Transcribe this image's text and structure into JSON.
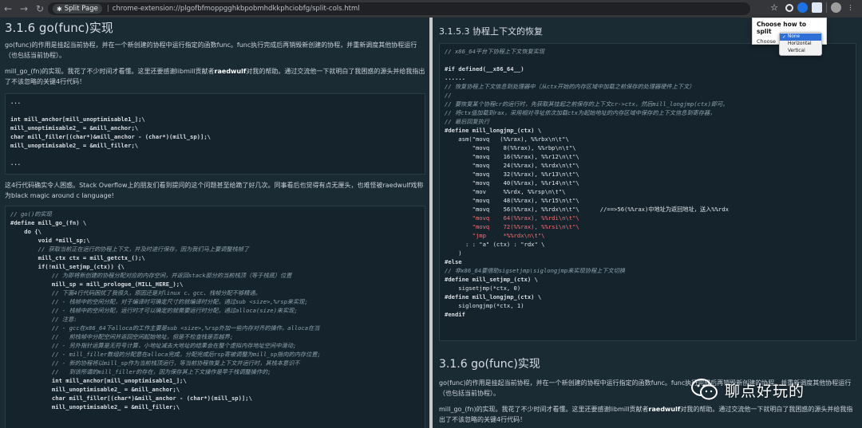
{
  "browser": {
    "back_icon": "←",
    "forward_icon": "→",
    "reload_icon": "↻",
    "ext_name": "Split Page",
    "url": "chrome-extension://plgofbfmoppgghkbpobmhdkkphciobfg/split-cols.html",
    "star_icon": "☆"
  },
  "popup": {
    "title": "Choose how to split",
    "choose_label": "Choose",
    "options": [
      {
        "label": "None",
        "selected": true,
        "check": "✓"
      },
      {
        "label": "Horizontal",
        "selected": false,
        "check": ""
      },
      {
        "label": "Vertical",
        "selected": false,
        "check": ""
      }
    ]
  },
  "left": {
    "heading": "3.1.6 go(func)实现",
    "para1": "go(func)的作用是挂起当前协程，并在一个新创建的协程中运行指定的函数func。func执行完成后再销毁新创建的协程，并重新调度其他协程运行（也包括当前协程）。",
    "para2_a": "mill_go_(fn)的实现。我花了不少时间才看懂。这里还要感谢libmill贡献者",
    "para2_b": "raedwulf",
    "para2_c": "对我的帮助。通过交流他一下就明白了我困惑的源头并给我指出了不该忽略的关键4行代码！",
    "code1": [
      "...",
      "",
      "int mill_anchor[mill_unoptimisable1_];\\",
      "mill_unoptimisable2_ = &mill_anchor;\\",
      "char mill_filler[(char*)&mill_anchor - (char*)(mill_sp)];\\",
      "mill_unoptimisable2_ = &mill_filler;\\",
      "",
      "..."
    ],
    "para3": "这4行代码确实令人困惑。Stack Overflow上的朋友们看到提问的这个问题甚至给跪了好几次。同事看后也觉得有点无厘头，也难怪被raedwulf戏称为black magic around c language!",
    "code2": [
      "// go()的实现",
      "#define mill_go_(fn) \\",
      "    do {\\",
      "        void *mill_sp;\\",
      "        // 获取当前正在运行的协程上下文，并及时进行保存，因为我们马上要调整栈帧了",
      "        mill_ctx ctx = mill_getctx_();\\",
      "        if(!mill_setjmp_(ctx)) {\\",
      "            // 为即将新创建的协程分配对应的内存空间，并返回stack部分的当前栈顶（等于栈底）位置",
      "            mill_sp = mill_prologue_(MILL_HERE_);\\",
      "            // 下面4行代码困扰了我很久，原因还是对linux c、gcc、栈帧分配不够精通。",
      "            // - 栈帧中的空间分配，对于编译时可确定尺寸的就编译时分配，通过sub <size>,%rsp来实现;",
      "            // - 栈帧中的空间分配，运行时才可以确定的就需要运行时分配，通过alloca(size)来实现;",
      "            // 注意:",
      "            // - gcc在x86_64下alloca的工作主要是sub <size>,%rsp外加一些内存对齐的操作。alloca在当",
      "            //   前栈帧中分配空间并返回空间起始地址，但是不检查栈是否越界;",
      "            // - 另外指针运算是无符号计算，小地址减去大地址的结果会在整个虚拟内存地址空间中滑动;",
      "            // - mill_filler数组的分配意在alloca完成，分配完成后rsp寄被调整为mill_sp指向的内存位置;",
      "            // - 新的协程将以mill_sp作为当前栈顶运行，等当前协程恢复上下文并运行时，其栈本意识不",
      "            //   到该所谓的mill_filler的存在，因为保存其上下文操作是早于栈调整操作的;",
      "            int mill_anchor[mill_unoptimisable1_];\\",
      "            mill_unoptimisable2_ = &mill_anchor;\\",
      "            char mill_filler[(char*)&mill_anchor - (char*)(mill_sp)];\\",
      "            mill_unoptimisable2_ = &mill_filler;\\"
    ]
  },
  "right": {
    "heading1": "3.1.5.3 协程上下文的恢复",
    "code3": [
      "// x86_64平台下协程上下文恢复实现",
      "",
      "#if defined(__x86_64__)",
      "......",
      "// 恢复协程上下文信息到处理器中（从ctx开始的内存区域中加载之前保存的处理器硬件上下文）",
      "//",
      "// 要恢复某个协程cr的运行时，先获取其挂起之前保存的上下文cr->ctx，然后mill_longjmp(ctx)即可。",
      "// 将ctx值加载到rax，采用相对寻址依次加载ctx为起始地址的内存区域中保存的上下文信息到寄存器，",
      "// 最后回复执行",
      "#define mill_longjmp_(ctx) \\",
      "    asm(\"movq   (%%rax), %%rbx\\n\\t\"\\",
      "        \"movq    8(%%rax), %%rbp\\n\\t\"\\",
      "        \"movq    16(%%rax), %%r12\\n\\t\"\\",
      "        \"movq    24(%%rax), %%rdx\\n\\t\"\\",
      "        \"movq    32(%%rax), %%r13\\n\\t\"\\",
      "        \"movq    40(%%rax), %%r14\\n\\t\"\\",
      "        \"mov     %%rdx, %%rsp\\n\\t\"\\",
      "        \"movq    48(%%rax), %%r15\\n\\t\"\\",
      "        \"movq    56(%%rax), %%rdx\\n\\t\"\\      //==>56(%%rax)中地址为返回地址，送入%%rdx",
      "        \"movq    64(%%rax), %%rdi\\n\\t\"\\",
      "        \"movq    72(%%rax), %%rsi\\n\\t\"\\",
      "        \"jmp     *%%rdx\\n\\t\"\\",
      "      : : \"a\" (ctx) : \"rdx\" \\",
      "    )",
      "#else",
      "// 非x86_64要借助sigsetjmp\\siglongjmp来实现协程上下文切换",
      "#define mill_setjmp_(ctx) \\",
      "    sigsetjmp(*ctx, 0)",
      "#define mill_longjmp_(ctx) \\",
      "    siglongjmp(*ctx, 1)",
      "#endif"
    ],
    "heading2": "3.1.6 go(func)实现",
    "para1": "go(func)的作用是挂起当前协程，并在一个新创建的协程中运行指定的函数func。func执行完成后再销毁新创建的协程，并重新调度其他协程运行（也包括当前协程）。",
    "para2_a": "mill_go_(fn)的实现。我花了不少时间才看懂。这里还要感谢libmill贡献者",
    "para2_b": "raedwulf",
    "para2_c": "对我的帮助。通过交流他一下就明白了我困惑的源头并给我指出了不该忽略的关键4行代码！"
  },
  "watermark": {
    "text": "聊点好玩的"
  }
}
